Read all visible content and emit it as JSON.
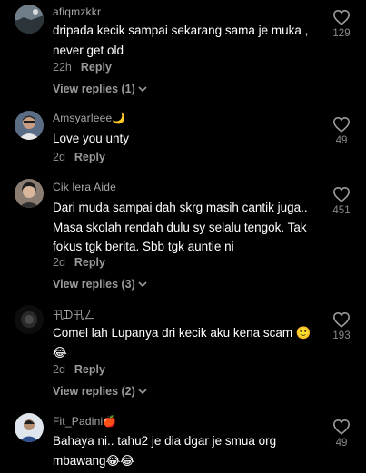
{
  "comments": [
    {
      "username": "afiqmzkkr",
      "text": "dripada kecik sampai sekarang sama je muka , never get old",
      "time": "22h",
      "reply_label": "Reply",
      "view_replies": "View replies (1)",
      "likes": "129",
      "avatar_icon": "avatar-landscape"
    },
    {
      "username": "Amsyarleee🌙",
      "text": "Love you unty",
      "time": "2d",
      "reply_label": "Reply",
      "likes": "49",
      "avatar_icon": "avatar-person"
    },
    {
      "username": "Cik lera Aide",
      "text": "Dari muda sampai dah skrg masih cantik juga.. Masa skolah rendah dulu sy selalu tengok. Tak fokus tgk berita. Sbb tgk auntie ni",
      "time": "2d",
      "reply_label": "Reply",
      "view_replies": "View replies (3)",
      "likes": "451",
      "avatar_icon": "avatar-person"
    },
    {
      "username": "卂ᗪ卂ㄥ",
      "text": "Comel lah Lupanya dri kecik aku kena scam 🙂😂",
      "time": "2d",
      "reply_label": "Reply",
      "view_replies": "View replies (2)",
      "likes": "193",
      "avatar_icon": "avatar-dark"
    },
    {
      "username": "Fit_Padini🍎",
      "text": "Bahaya ni.. tahu2 je dia dgar je smua org mbawang😂😂",
      "time": "",
      "reply_label": "",
      "likes": "49",
      "avatar_icon": "avatar-person"
    }
  ],
  "colors": {
    "background": "#000000",
    "text": "#ffffff",
    "muted": "#8a8a8a"
  }
}
